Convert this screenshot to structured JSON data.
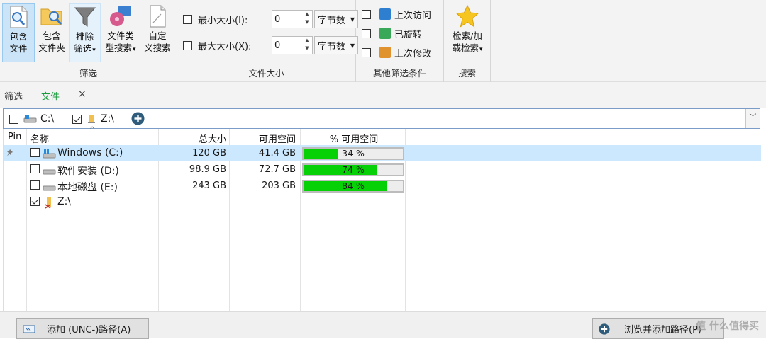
{
  "ribbon": {
    "filter_group": {
      "label": "筛选",
      "buttons": [
        {
          "line1": "包含",
          "line2": "文件"
        },
        {
          "line1": "包含",
          "line2": "文件夹"
        },
        {
          "line1": "排除",
          "line2": "筛选"
        },
        {
          "line1": "文件类",
          "line2": "型搜索"
        },
        {
          "line1": "自定",
          "line2": "义搜索"
        }
      ]
    },
    "size_group": {
      "label": "文件大小",
      "min_label": "最小大小(I):",
      "min_value": "0",
      "min_unit": "字节数",
      "max_label": "最大大小(X):",
      "max_value": "0",
      "max_unit": "字节数"
    },
    "other_group": {
      "label": "其他筛选条件",
      "items": [
        "上次访问",
        "已旋转",
        "上次修改"
      ]
    },
    "search_group": {
      "label": "搜索",
      "button_line1": "检索/加",
      "button_line2": "载检索"
    }
  },
  "tabs": {
    "filter": "筛选",
    "files": "文件",
    "close": "×"
  },
  "pathbar": {
    "items": [
      {
        "label": "C:\\",
        "checked": false
      },
      {
        "label": "Z:\\",
        "checked": true
      }
    ]
  },
  "table": {
    "headers": {
      "pin": "Pin",
      "name": "名称",
      "total": "总大小",
      "free": "可用空间",
      "pct": "% 可用空间"
    },
    "rows": [
      {
        "name": "Windows (C:)",
        "total": "120 GB",
        "free": "41.4 GB",
        "pct_label": "34 %",
        "pct": 34,
        "checked": false,
        "selected": true,
        "pinned": true
      },
      {
        "name": "软件安装 (D:)",
        "total": "98.9 GB",
        "free": "72.7 GB",
        "pct_label": "74 %",
        "pct": 74,
        "checked": false,
        "selected": false,
        "pinned": false
      },
      {
        "name": "本地磁盘 (E:)",
        "total": "243 GB",
        "free": "203 GB",
        "pct_label": "84 %",
        "pct": 84,
        "checked": false,
        "selected": false,
        "pinned": false
      },
      {
        "name": "Z:\\",
        "total": "",
        "free": "",
        "pct_label": "",
        "pct": null,
        "checked": true,
        "selected": false,
        "pinned": false
      }
    ]
  },
  "footer": {
    "add_unc": "添加 (UNC-)路径(A)",
    "browse_add": "浏览并添加路径(P)",
    "watermark": "值 什么值得买"
  },
  "colors": {
    "accent": "#0078d7",
    "bar_fill": "#06d106",
    "selected_row": "#cce8ff",
    "tab_active": "#1a9c3c"
  }
}
